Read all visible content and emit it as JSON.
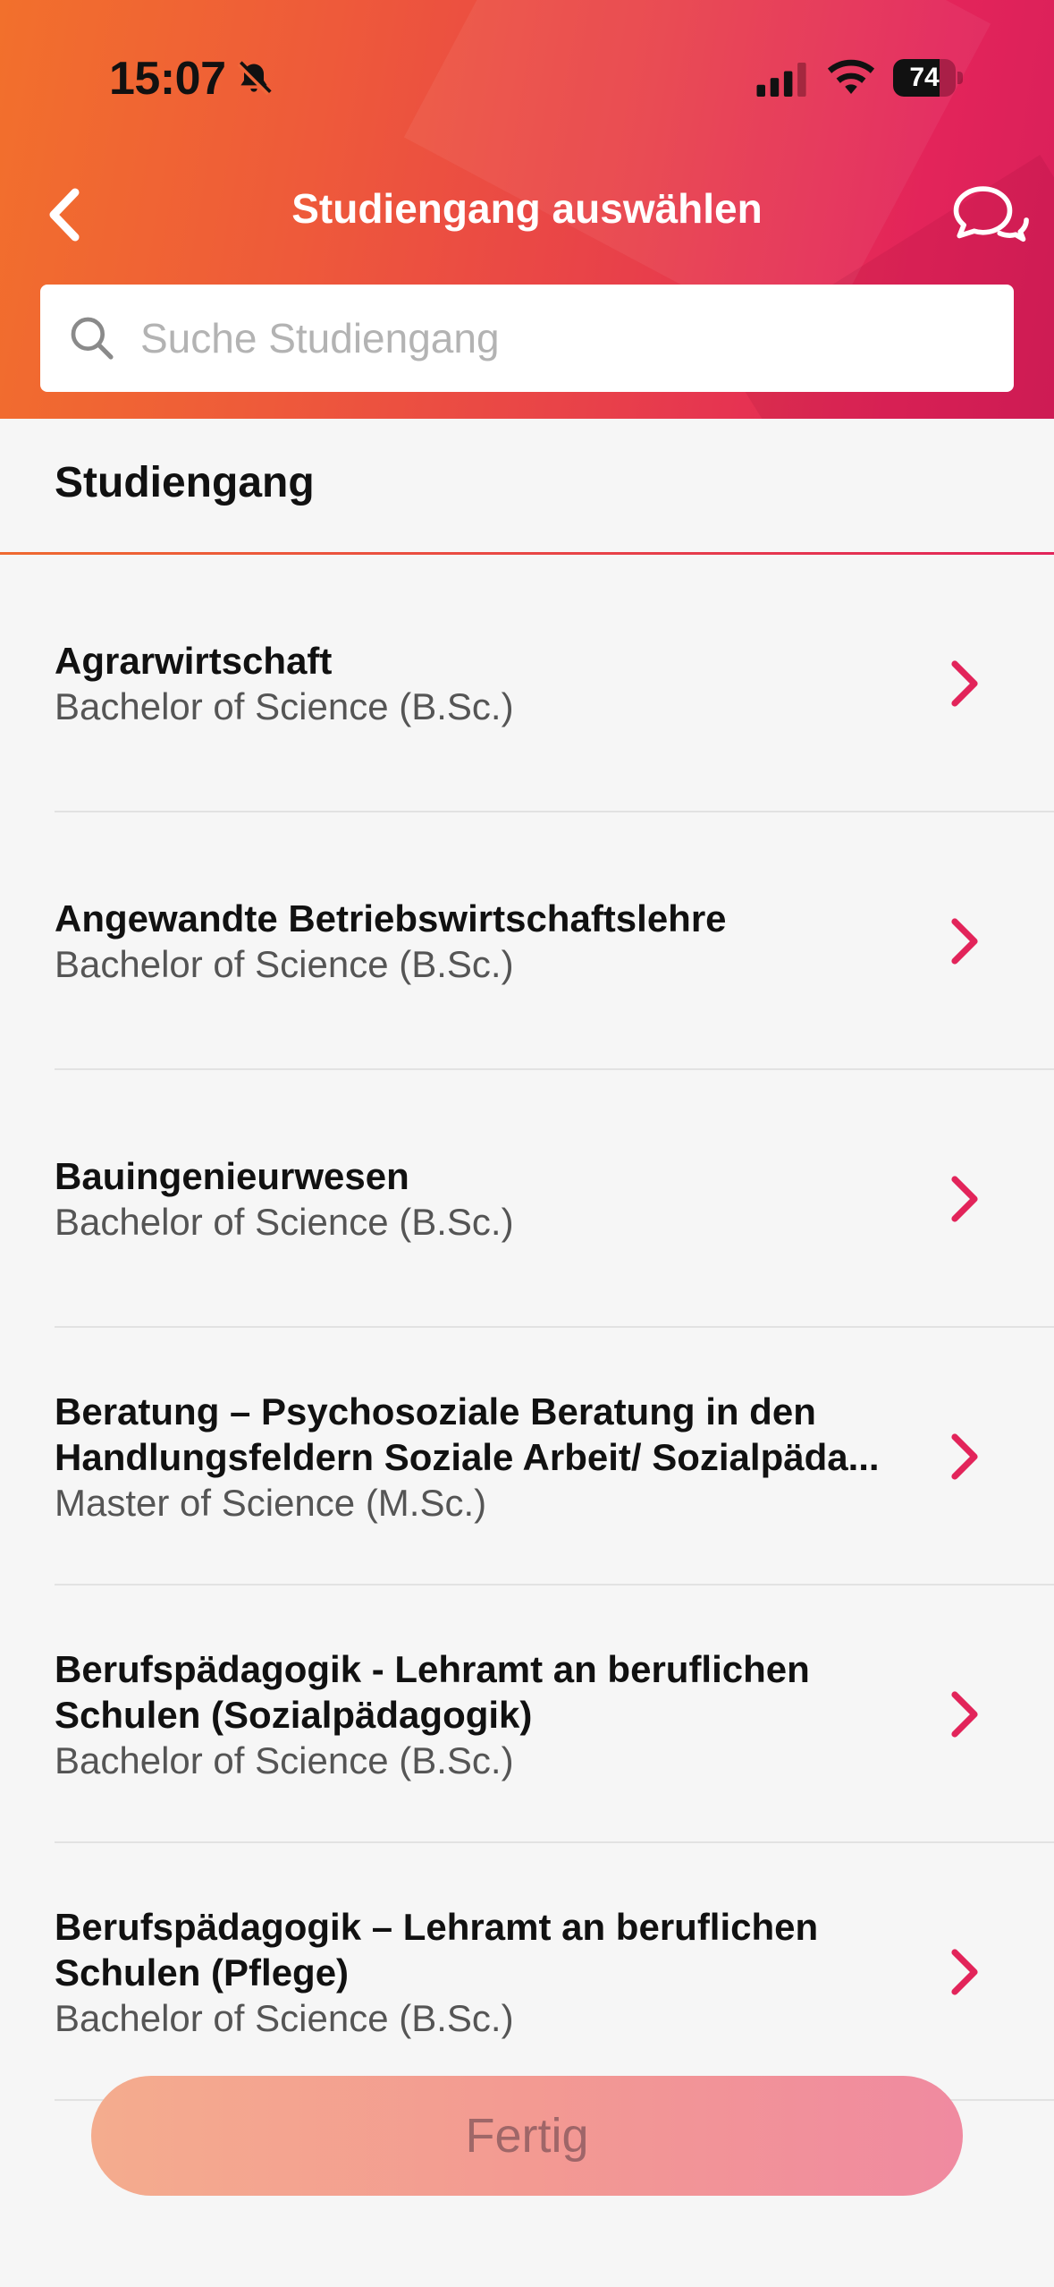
{
  "status_bar": {
    "time": "15:07",
    "battery": "74",
    "battery_level": 0.74
  },
  "nav": {
    "title": "Studiengang auswählen",
    "back_icon": "chevron-left-icon",
    "chat_icon": "chat-bubbles-icon"
  },
  "search": {
    "placeholder": "Suche Studiengang",
    "value": ""
  },
  "section": {
    "title": "Studiengang"
  },
  "programs": [
    {
      "name": "Agrarwirtschaft",
      "degree": "Bachelor of Science (B.Sc.)"
    },
    {
      "name": "Angewandte Betriebswirtschaftslehre",
      "degree": "Bachelor of Science (B.Sc.)"
    },
    {
      "name": "Bauingenieurwesen",
      "degree": "Bachelor of Science (B.Sc.)"
    },
    {
      "name": "Beratung – Psychosoziale Beratung in den Handlungsfeldern  Soziale Arbeit/ Sozialpäda...",
      "degree": "Master of Science (M.Sc.)"
    },
    {
      "name": "Berufspädagogik - Lehramt an beruflichen Schulen (Sozialpädagogik)",
      "degree": "Bachelor of Science (B.Sc.)"
    },
    {
      "name": "Berufspädagogik – Lehramt an beruflichen Schulen (Pflege)",
      "degree": "Bachelor of Science (B.Sc.)"
    }
  ],
  "footer": {
    "done_label": "Fertig"
  },
  "colors": {
    "accent": "#e2245a",
    "gradient_start": "#f2702c",
    "gradient_end": "#d81f5a"
  }
}
